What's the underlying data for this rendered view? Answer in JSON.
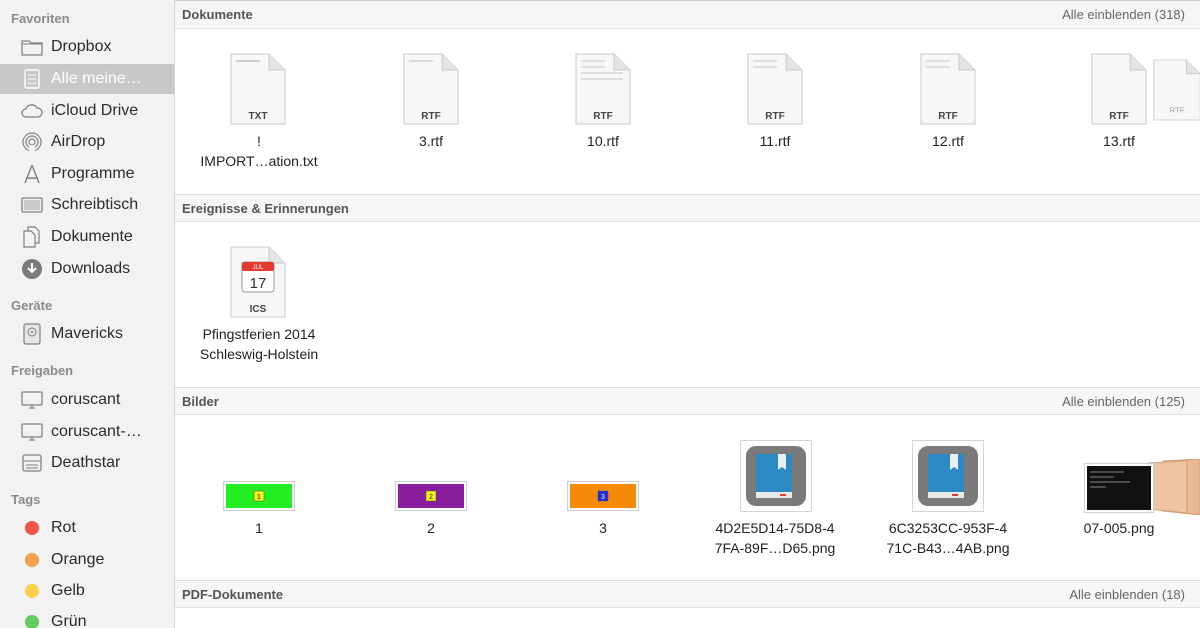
{
  "sidebar": {
    "favorites_header": "Favoriten",
    "favorites": [
      {
        "label": "Dropbox",
        "icon": "folder-icon"
      },
      {
        "label": "Alle meine…",
        "icon": "all-files-icon",
        "selected": true
      },
      {
        "label": "iCloud Drive",
        "icon": "cloud-icon"
      },
      {
        "label": "AirDrop",
        "icon": "airdrop-icon"
      },
      {
        "label": "Programme",
        "icon": "applications-icon"
      },
      {
        "label": "Schreibtisch",
        "icon": "desktop-icon"
      },
      {
        "label": "Dokumente",
        "icon": "documents-icon"
      },
      {
        "label": "Downloads",
        "icon": "downloads-icon"
      }
    ],
    "devices_header": "Geräte",
    "devices": [
      {
        "label": "Mavericks",
        "icon": "disk-icon"
      }
    ],
    "shared_header": "Freigaben",
    "shared": [
      {
        "label": "coruscant",
        "icon": "monitor-icon"
      },
      {
        "label": "coruscant-…",
        "icon": "monitor-icon"
      },
      {
        "label": "Deathstar",
        "icon": "server-icon"
      }
    ],
    "tags_header": "Tags",
    "tags": [
      {
        "label": "Rot",
        "color": "#f4524d"
      },
      {
        "label": "Orange",
        "color": "#f6a04d"
      },
      {
        "label": "Gelb",
        "color": "#fcd04e"
      },
      {
        "label": "Grün",
        "color": "#62cd5b"
      }
    ]
  },
  "sections": {
    "documents": {
      "title": "Dokumente",
      "show_all": "Alle einblenden (318)",
      "files": [
        {
          "name": "!\nIMPORT…ation.txt",
          "type": "TXT"
        },
        {
          "name": "3.rtf",
          "type": "RTF"
        },
        {
          "name": "10.rtf",
          "type": "RTF"
        },
        {
          "name": "11.rtf",
          "type": "RTF"
        },
        {
          "name": "12.rtf",
          "type": "RTF"
        },
        {
          "name": "13.rtf",
          "type": "RTF"
        }
      ]
    },
    "events": {
      "title": "Ereignisse & Erinnerungen",
      "files": [
        {
          "name": "Pfingstferien 2014\nSchleswig-Holstein",
          "type": "ICS",
          "month": "JUL",
          "day": "17"
        }
      ]
    },
    "images": {
      "title": "Bilder",
      "show_all": "Alle einblenden (125)",
      "files": [
        {
          "name": "1",
          "color": "#22ee22",
          "badge": "1",
          "badge_color": "#f2f21a"
        },
        {
          "name": "2",
          "color": "#8a1d9e",
          "badge": "2",
          "badge_color": "#f2f21a"
        },
        {
          "name": "3",
          "color": "#f78a0a",
          "badge": "3",
          "badge_color": "#1c2ae0"
        },
        {
          "name": "4D2E5D14-75D8-4\n7FA-89F…D65.png",
          "icon": "book-app-icon"
        },
        {
          "name": "6C3253CC-953F-4\n71C-B43…4AB.png",
          "icon": "book-app-icon"
        },
        {
          "name": "07-005.png",
          "icon": "terminal-screenshot-icon"
        }
      ]
    },
    "pdf": {
      "title": "PDF-Dokumente",
      "show_all": "Alle einblenden (18)"
    }
  }
}
